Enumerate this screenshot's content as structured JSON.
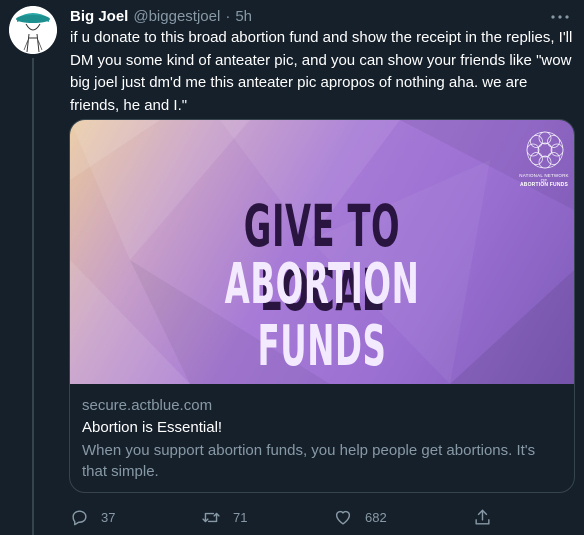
{
  "tweet": {
    "author": {
      "display_name": "Big Joel",
      "handle": "@biggestjoel",
      "separator": "·",
      "time": "5h"
    },
    "text": "if u donate to this broad abortion fund and show the receipt in the replies, I'll DM you some kind of anteater pic, and you can show your friends like \"wow big joel just dm'd me this anteater pic apropos of nothing aha. we are friends, he and I.\"",
    "card": {
      "image": {
        "headline_line1": "GIVE TO LOCAL",
        "headline_line2": "ABORTION FUNDS",
        "logo_text_small": "NATIONAL NETWORK OF",
        "logo_text_large": "ABORTION FUNDS"
      },
      "domain": "secure.actblue.com",
      "title": "Abortion is Essential!",
      "description": "When you support abortion funds, you help people get abortions. It's that simple."
    },
    "actions": {
      "reply_count": "37",
      "retweet_count": "71",
      "like_count": "682"
    }
  },
  "icons": {
    "more": "more-horizontal-icon",
    "reply": "reply-icon",
    "retweet": "retweet-icon",
    "like": "heart-icon",
    "share": "share-icon"
  },
  "colors": {
    "background": "#15202b",
    "secondary_text": "#8899a6",
    "border": "#38444d",
    "card_gradient_start": "#e9c79c",
    "card_gradient_end": "#7e5bb8",
    "headline_dark": "#2a1540",
    "headline_light": "#f3eaff"
  }
}
